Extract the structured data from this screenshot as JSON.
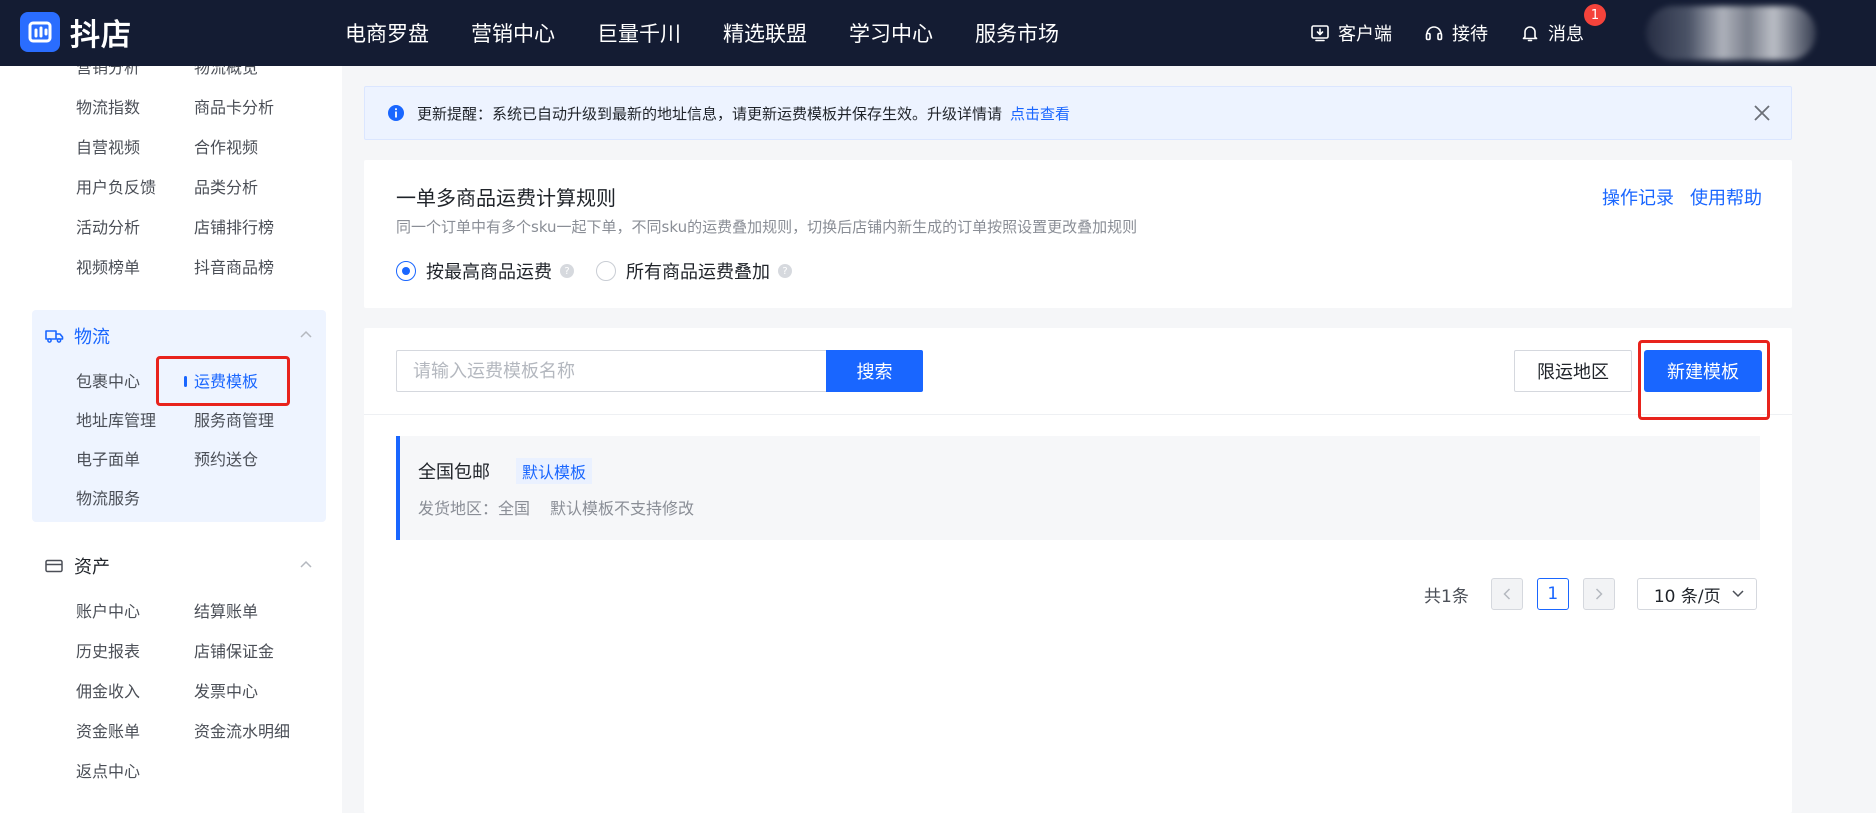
{
  "app": {
    "logo_text": "抖店"
  },
  "topnav": [
    {
      "label": "电商罗盘"
    },
    {
      "label": "营销中心"
    },
    {
      "label": "巨量千川"
    },
    {
      "label": "精选联盟"
    },
    {
      "label": "学习中心"
    },
    {
      "label": "服务市场"
    }
  ],
  "topright": {
    "client_label": "客户端",
    "service_label": "接待",
    "message_label": "消息",
    "message_badge": "1"
  },
  "sidebar": {
    "data_items": [
      "营销分析",
      "物流概览",
      "物流指数",
      "商品卡分析",
      "自营视频",
      "合作视频",
      "用户负反馈",
      "品类分析",
      "活动分析",
      "店铺排行榜",
      "视频榜单",
      "抖音商品榜"
    ],
    "logistics": {
      "title": "物流",
      "items": [
        "包裹中心",
        "运费模板",
        "地址库管理",
        "服务商管理",
        "电子面单",
        "预约送仓",
        "物流服务"
      ]
    },
    "assets": {
      "title": "资产",
      "items": [
        "账户中心",
        "结算账单",
        "历史报表",
        "店铺保证金",
        "佣金收入",
        "发票中心",
        "资金账单",
        "资金流水明细",
        "返点中心"
      ]
    }
  },
  "notice": {
    "text": "更新提醒：系统已自动升级到最新的地址信息，请更新运费模板并保存生效。升级详情请",
    "link": "点击查看"
  },
  "rule_card": {
    "title": "一单多商品运费计算规则",
    "desc": "同一个订单中有多个sku一起下单，不同sku的运费叠加规则，切换后店铺内新生成的订单按照设置更改叠加规则",
    "link_records": "操作记录",
    "link_help": "使用帮助",
    "option_max": "按最高商品运费",
    "option_sum": "所有商品运费叠加",
    "selected": "按最高商品运费"
  },
  "search": {
    "placeholder": "请输入运费模板名称",
    "value": "",
    "button": "搜索"
  },
  "actions": {
    "limit_area": "限运地区",
    "new_template": "新建模板"
  },
  "templates": [
    {
      "name": "全国包邮",
      "tag": "默认模板",
      "ship_area": "发货地区：全国",
      "note": "默认模板不支持修改"
    }
  ],
  "pagination": {
    "total": "共1条",
    "current_page": "1",
    "page_size": "10 条/页"
  },
  "colors": {
    "topbar": "#141c33",
    "primary": "#1966ff",
    "highlight": "#e8231c",
    "badge": "#f5433b"
  }
}
